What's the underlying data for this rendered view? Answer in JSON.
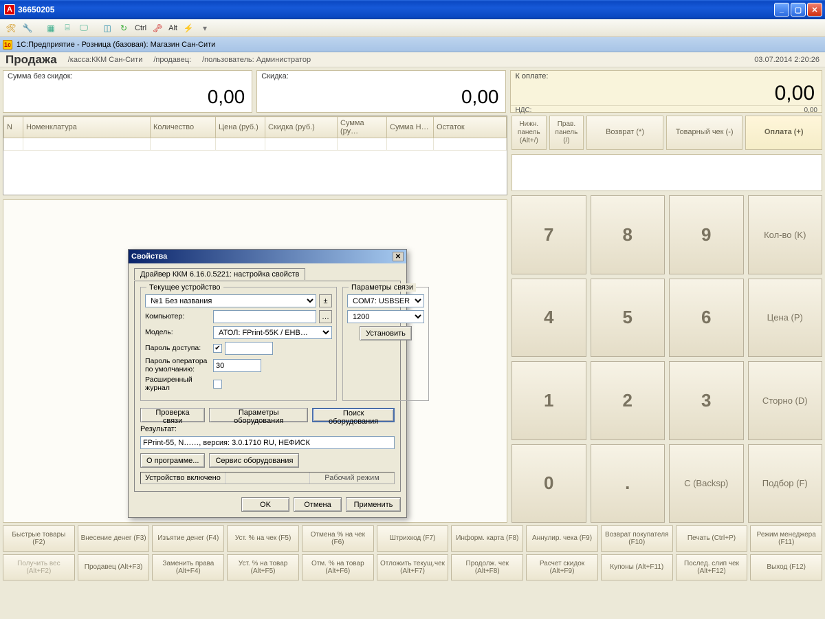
{
  "window": {
    "title": "36650205"
  },
  "subtitle": "1С:Предприятие - Розница (базовая): Магазин Сан-Сити",
  "header": {
    "title": "Продажа",
    "cashier": "/касса:ККМ Сан-Сити",
    "seller": "/продавец:",
    "user": "/пользователь: Администратор",
    "datetime": "03.07.2014 2:20:26"
  },
  "toolbar": {
    "ctrl": "Ctrl",
    "alt": "Alt"
  },
  "totals": {
    "no_discount_label": "Сумма без скидок:",
    "no_discount_value": "0,00",
    "discount_label": "Скидка:",
    "discount_value": "0,00",
    "topay_label": "К оплате:",
    "topay_value": "0,00",
    "nds_label": "НДС:",
    "nds_value": "0,00"
  },
  "actions": {
    "bottom_panel": "Нижн.\nпанель\n(Alt+/)",
    "right_panel": "Прав.\nпанель\n(/)",
    "return": "Возврат (*)",
    "receipt": "Товарный чек (-)",
    "pay": "Оплата (+)"
  },
  "columns": {
    "n": "N",
    "name": "Номенклатура",
    "qty": "Количество",
    "price": "Цена (руб.)",
    "discount": "Скидка (руб.)",
    "sum": "Сумма (ру…",
    "sum_n": "Сумма Н…",
    "rest": "Остаток"
  },
  "keypad": {
    "k7": "7",
    "k8": "8",
    "k9": "9",
    "qty": "Кол-во (K)",
    "k4": "4",
    "k5": "5",
    "k6": "6",
    "price": "Цена (P)",
    "k1": "1",
    "k2": "2",
    "k3": "3",
    "storno": "Сторно (D)",
    "k0": "0",
    "dot": ".",
    "back": "C (Backsp)",
    "pick": "Подбор (F)"
  },
  "bottom": [
    [
      "Быстрые товары (F2)",
      "Внесение денег (F3)",
      "Изъятие денег (F4)",
      "Уст. % на чек (F5)",
      "Отмена % на чек (F6)",
      "Штрихкод (F7)",
      "Информ. карта (F8)",
      "Аннулир. чека (F9)",
      "Возврат покупателя (F10)",
      "Печать (Ctrl+P)",
      "Режим менеджера (F11)"
    ],
    [
      "Получить вес (Alt+F2)",
      "Продавец (Alt+F3)",
      "Заменить права (Alt+F4)",
      "Уст. % на товар (Alt+F5)",
      "Отм. % на товар (Alt+F6)",
      "Отложить текущ.чек (Alt+F7)",
      "Продолж. чек (Alt+F8)",
      "Расчет скидок (Alt+F9)",
      "Купоны (Alt+F11)",
      "Послед. слип чек (Alt+F12)",
      "Выход (F12)"
    ]
  ],
  "dialog": {
    "title": "Свойства",
    "tab": "Драйвер ККМ 6.16.0.5221: настройка свойств",
    "fs_device": "Текущее устройство",
    "device_value": "№1 Без названия",
    "computer_label": "Компьютер:",
    "computer_value": "",
    "model_label": "Модель:",
    "model_value": "АТОЛ: FPrint-55K / ЕНВ…",
    "pwd_label": "Пароль доступа:",
    "oper_pwd_label": "Пароль оператора по умолчанию:",
    "oper_pwd_value": "30",
    "ext_log_label": "Расширенный журнал",
    "fs_conn": "Параметры связи",
    "port_value": "COM7: USBSER",
    "baud_value": "1200",
    "set_btn": "Установить",
    "check_btn": "Проверка связи",
    "params_btn": "Параметры оборудования",
    "search_btn": "Поиск оборудования",
    "result_label": "Результат:",
    "result_value": "FPrint-55, N……, версия: 3.0.1710 RU, НЕФИСК",
    "about_btn": "О программе...",
    "service_btn": "Сервис оборудования",
    "status1": "Устройство включено",
    "status2": "Рабочий режим",
    "ok": "OK",
    "cancel": "Отмена",
    "apply": "Применить"
  }
}
